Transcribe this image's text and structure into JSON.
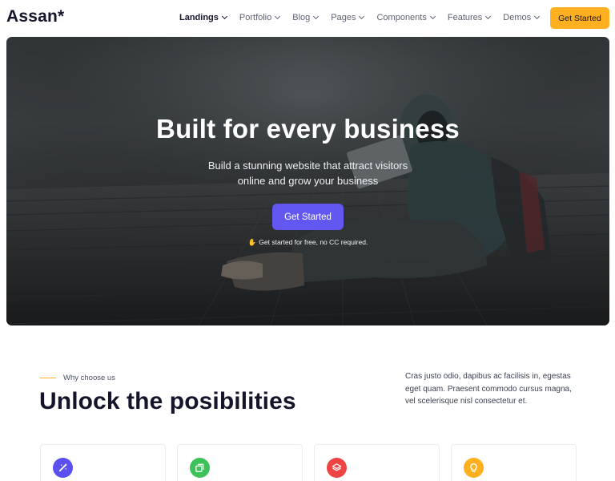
{
  "brand": {
    "logo": "Assan*"
  },
  "nav": {
    "items": [
      {
        "label": "Landings",
        "active": true
      },
      {
        "label": "Portfolio",
        "active": false
      },
      {
        "label": "Blog",
        "active": false
      },
      {
        "label": "Pages",
        "active": false
      },
      {
        "label": "Components",
        "active": false
      },
      {
        "label": "Features",
        "active": false
      },
      {
        "label": "Demos",
        "active": false
      }
    ],
    "cta_label": "Get Started"
  },
  "hero": {
    "title": "Built for every business",
    "subtitle": "Build a stunning website that attract visitors online and grow your business",
    "cta_label": "Get Started",
    "note": "Get started for free, no CC required.",
    "note_icon": "hand-icon"
  },
  "why": {
    "eyebrow": "Why choose us",
    "title": "Unlock the posibilities",
    "description": "Cras justo odio, dapibus ac facilisis in, egestas eget quam. Praesent commodo cursus magna, vel scelerisque nisl consectetur et."
  },
  "cards": [
    {
      "icon": "magic-wand-icon",
      "color": "#5b4ff0"
    },
    {
      "icon": "copy-icon",
      "color": "#3dc25a"
    },
    {
      "icon": "layers-icon",
      "color": "#ef4444"
    },
    {
      "icon": "lightbulb-icon",
      "color": "#ffb020"
    }
  ],
  "colors": {
    "accent": "#6357f2",
    "cta": "#ffb020",
    "text_dark": "#14142b"
  }
}
